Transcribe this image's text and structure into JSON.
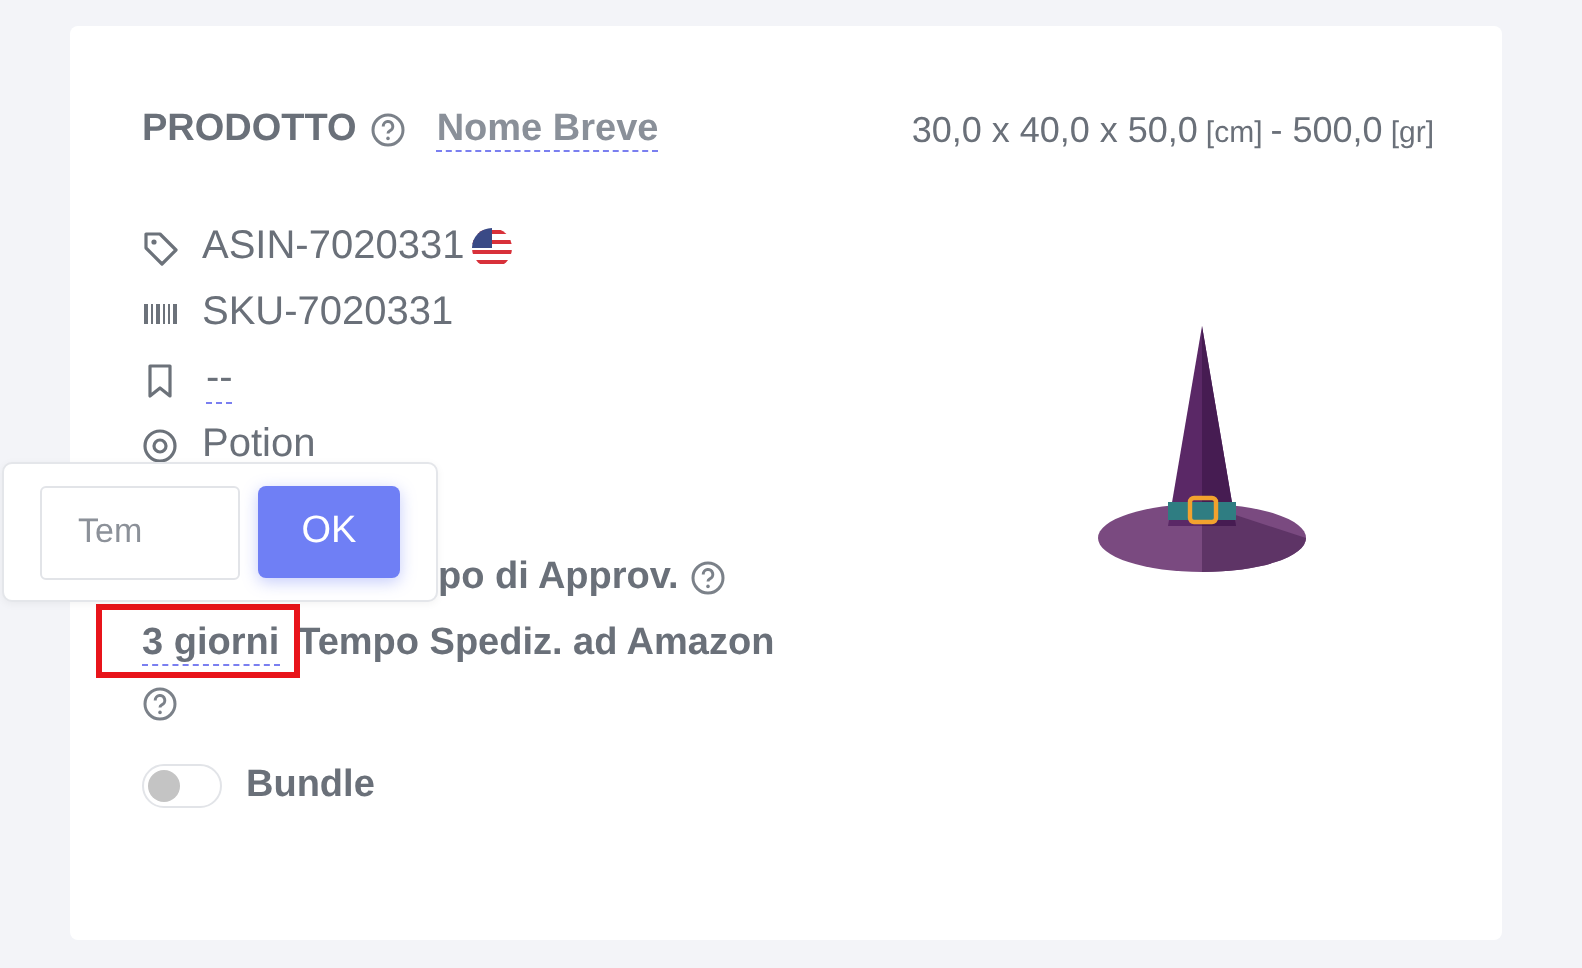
{
  "header": {
    "title": "PRODOTTO",
    "short_name": "Nome Breve",
    "size": "30,0 x 40,0 x 50,0",
    "size_unit": "[cm]",
    "weight": "- 500,0",
    "weight_unit": "[gr]"
  },
  "rows": [
    {
      "kind": "asin",
      "text": "ASIN-7020331"
    },
    {
      "kind": "sku",
      "text": "SKU-7020331"
    },
    {
      "kind": "bookmark",
      "value": "--"
    },
    {
      "kind": "category",
      "text": "Potion"
    },
    {
      "kind": "lead-time",
      "label": "po di Approv."
    },
    {
      "kind": "shipping",
      "value": "3 giorni",
      "label": "Tempo Spediz. ad Amazon",
      "highlighted": true
    }
  ],
  "bundle": {
    "label": "Bundle",
    "on": false
  },
  "popover": {
    "placeholder": "Tem",
    "button": "OK"
  }
}
